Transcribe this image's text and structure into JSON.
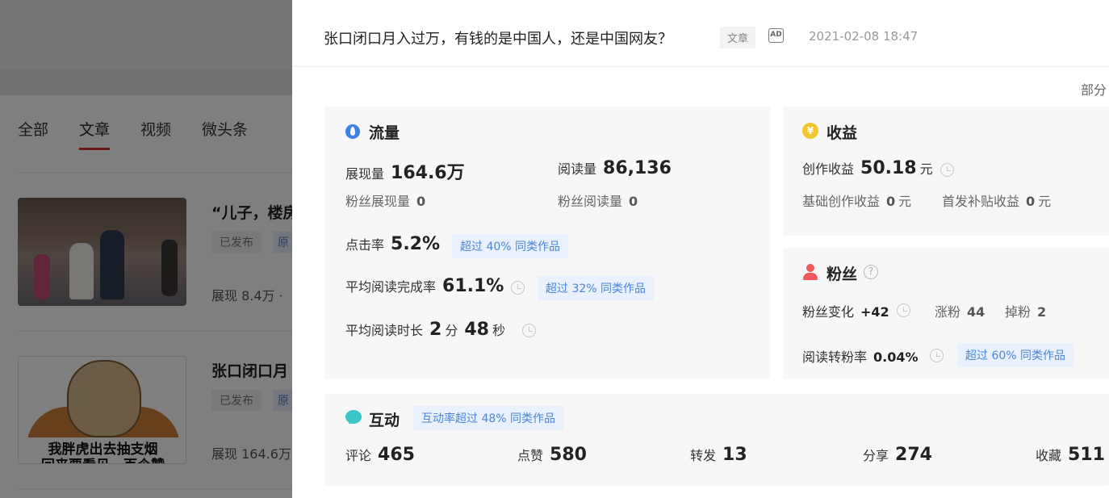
{
  "background": {
    "tabs": [
      "全部",
      "文章",
      "视频",
      "微头条"
    ],
    "active_tab": "文章",
    "items": [
      {
        "title": "“儿子，楼房",
        "status": "已发布",
        "tag": "原",
        "stat": "展现 8.4万 ·"
      },
      {
        "title": "张口闭口月",
        "status": "已发布",
        "tag": "原",
        "stat": "展现 164.6万",
        "thumb_caption_1": "我胖虎出去抽支烟",
        "thumb_caption_2": "回来要看见一百个赞"
      }
    ]
  },
  "header": {
    "title": "张口闭口月入过万，有钱的是中国人，还是中国网友？",
    "type_badge": "文章",
    "ad_icon": "AD",
    "date": "2021-02-08 18:47"
  },
  "partial_label": "部分",
  "traffic": {
    "title": "流量",
    "impressions_label": "展现量",
    "impressions_value": "164.6万",
    "reads_label": "阅读量",
    "reads_value": "86,136",
    "fan_impressions_label": "粉丝展现量",
    "fan_impressions_value": "0",
    "fan_reads_label": "粉丝阅读量",
    "fan_reads_value": "0",
    "ctr_label": "点击率",
    "ctr_value": "5.2%",
    "ctr_pill": "超过 40% 同类作品",
    "completion_label": "平均阅读完成率",
    "completion_value": "61.1%",
    "completion_pill": "超过 32% 同类作品",
    "duration_label": "平均阅读时长",
    "duration_min": "2",
    "duration_min_unit": "分",
    "duration_sec": "48",
    "duration_sec_unit": "秒"
  },
  "income": {
    "title": "收益",
    "icon_text": "¥",
    "creation_label": "创作收益",
    "creation_value": "50.18",
    "creation_unit": "元",
    "base_label": "基础创作收益",
    "base_value": "0",
    "base_unit": "元",
    "first_label": "首发补贴收益",
    "first_value": "0",
    "first_unit": "元"
  },
  "fans": {
    "title": "粉丝",
    "help_icon": "?",
    "change_label": "粉丝变化",
    "change_value": "+42",
    "gain_label": "涨粉",
    "gain_value": "44",
    "loss_label": "掉粉",
    "loss_value": "2",
    "conversion_label": "阅读转粉率",
    "conversion_value": "0.04%",
    "conversion_pill": "超过 60% 同类作品"
  },
  "interaction": {
    "title": "互动",
    "pill": "互动率超过 48% 同类作品",
    "comments_label": "评论",
    "comments_value": "465",
    "likes_label": "点赞",
    "likes_value": "580",
    "reposts_label": "转发",
    "reposts_value": "13",
    "shares_label": "分享",
    "shares_value": "274",
    "favorites_label": "收藏",
    "favorites_value": "511"
  },
  "colors": {
    "accent_blue": "#4a86d8",
    "tab_active": "#d43030",
    "card_bg": "#f7f7f7"
  }
}
